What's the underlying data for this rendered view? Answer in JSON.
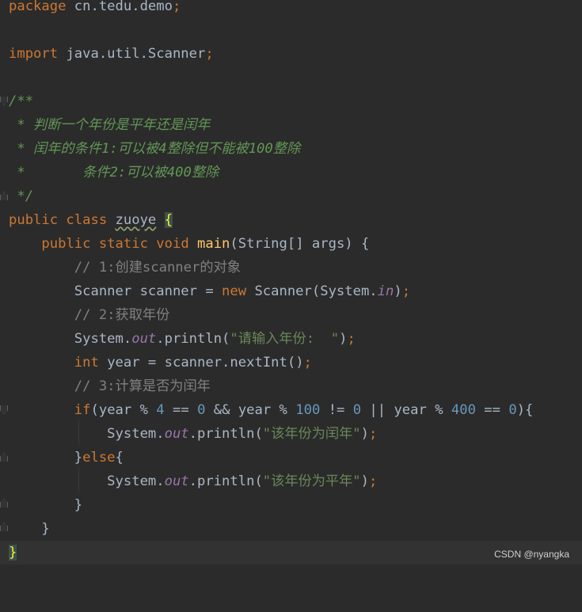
{
  "code": {
    "l1_package": "package",
    "l1_name": " cn.tedu.demo",
    "l1_semi": ";",
    "l3_import": "import",
    "l3_name": " java.util.Scanner",
    "l3_semi": ";",
    "l5": "/**",
    "l6": " * 判断一个年份是平年还是闰年",
    "l7": " * 闰年的条件1:可以被4整除但不能被100整除",
    "l8": " *       条件2:可以被400整除",
    "l9": " */",
    "l10_kw": "public class ",
    "l10_name": "zuoye",
    "l10_brace": "{",
    "l11_indent": "    ",
    "l11_kw": "public static void ",
    "l11_fn": "main",
    "l11_rest": "(String[] args) {",
    "l12": "        // 1:创建scanner的对象",
    "l13_a": "        Scanner scanner = ",
    "l13_new": "new",
    "l13_b": " Scanner(System.",
    "l13_in": "in",
    "l13_c": ")",
    "l13_semi": ";",
    "l14": "        // 2:获取年份",
    "l15_a": "        System.",
    "l15_out": "out",
    "l15_b": ".println(",
    "l15_str": "\"请输入年份:  \"",
    "l15_c": ")",
    "l15_semi": ";",
    "l16_indent": "        ",
    "l16_int": "int",
    "l16_b": " year = scanner.nextInt()",
    "l16_semi": ";",
    "l17": "        // 3:计算是否为闰年",
    "l18_indent": "        ",
    "l18_if": "if",
    "l18_a": "(year % ",
    "l18_n1": "4",
    "l18_b": " == ",
    "l18_n2": "0",
    "l18_c": " && year % ",
    "l18_n3": "100",
    "l18_d": " != ",
    "l18_n4": "0",
    "l18_e": " || year % ",
    "l18_n5": "400",
    "l18_f": " == ",
    "l18_n6": "0",
    "l18_g": "){",
    "l19_a": "            System.",
    "l19_out": "out",
    "l19_b": ".println(",
    "l19_str": "\"该年份为闰年\"",
    "l19_c": ")",
    "l19_semi": ";",
    "l20_a": "        }",
    "l20_else": "else",
    "l20_b": "{",
    "l21_a": "            System.",
    "l21_out": "out",
    "l21_b": ".println(",
    "l21_str": "\"该年份为平年\"",
    "l21_c": ")",
    "l21_semi": ";",
    "l22": "        }",
    "l23": "    }",
    "l24": "}"
  },
  "watermark": "CSDN @nyangka",
  "colors": {
    "background": "#2b2b2b",
    "keyword": "#cc7832",
    "string": "#6a8759",
    "number": "#6897bb",
    "comment": "#808080",
    "doc_comment": "#629755",
    "function": "#ffc66d",
    "static_field": "#9876aa"
  }
}
